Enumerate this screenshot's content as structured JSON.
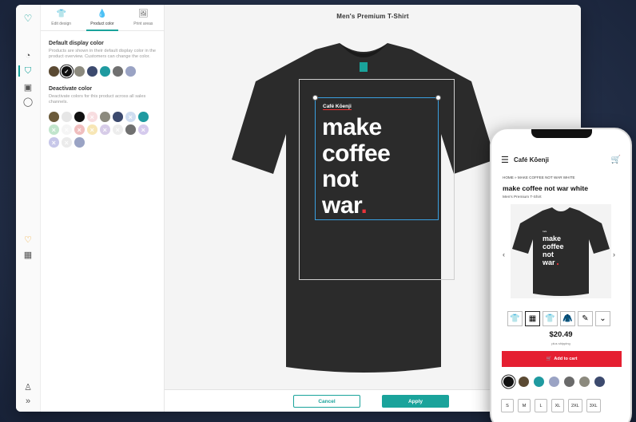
{
  "panel": {
    "tabs": [
      {
        "label": "Edit design",
        "icon": "tshirt-icon"
      },
      {
        "label": "Product color",
        "icon": "droplet-icon"
      },
      {
        "label": "Print areas",
        "icon": "image-icon"
      }
    ],
    "default_color": {
      "heading": "Default display color",
      "description": "Products are shown in their default display color in the product overview. Customers can change the color.",
      "swatches": [
        "#5b4a33",
        "#111111",
        "#8c8a7e",
        "#3c4a6e",
        "#1f9aa0",
        "#707070",
        "#9aa3c4"
      ]
    },
    "deactivate": {
      "heading": "Deactivate color",
      "description": "Deactivate colors for this product across all sales channels.",
      "swatches": [
        {
          "c": "#6b5a3a",
          "off": false
        },
        {
          "c": "#e6e6e6",
          "off": false
        },
        {
          "c": "#111111",
          "off": false
        },
        {
          "c": "#f3c2c8",
          "off": true
        },
        {
          "c": "#8c8a7e",
          "off": false
        },
        {
          "c": "#3c4a6e",
          "off": false
        },
        {
          "c": "#a9c3e6",
          "off": true
        },
        {
          "c": "#1f9aa0",
          "off": false
        },
        {
          "c": "#8fd0a3",
          "off": true
        },
        {
          "c": "#eeeeee",
          "off": true
        },
        {
          "c": "#e58a8a",
          "off": true
        },
        {
          "c": "#f2d27a",
          "off": true
        },
        {
          "c": "#b7a3d6",
          "off": true
        },
        {
          "c": "#e0e0e0",
          "off": true
        },
        {
          "c": "#707070",
          "off": false
        },
        {
          "c": "#b3a0e0",
          "off": true
        },
        {
          "c": "#9a9ad8",
          "off": true
        },
        {
          "c": "#dcdcdc",
          "off": true
        },
        {
          "c": "#9aa3c4",
          "off": false
        }
      ]
    }
  },
  "main": {
    "title": "Men's Premium T-Shirt",
    "design": {
      "brand": "Café Kōenji",
      "lines": [
        "make",
        "coffee",
        "not",
        "war"
      ],
      "dot": "."
    },
    "cancel_label": "Cancel",
    "apply_label": "Apply"
  },
  "phone": {
    "shop_name": "Café Kōenji",
    "breadcrumb": "HOME  »  MAKE COFFEE NOT WAR WHITE",
    "product_title": "make coffee not war white",
    "product_subtitle": "Men's Premium T-Shirt",
    "price": "$20.49",
    "shipping": "plus shipping",
    "cart_label": "Add to cart",
    "swatches": [
      "#111111",
      "#5b4a33",
      "#1f9aa0",
      "#9aa3c4",
      "#6a6a6a",
      "#8c8a7e",
      "#3c4a6e"
    ],
    "sizes": [
      "S",
      "M",
      "L",
      "XL",
      "2XL",
      "3XL"
    ]
  },
  "colors": {
    "accent": "#1aa39b",
    "cart": "#e51f31",
    "shirt": "#2b2b2b"
  }
}
